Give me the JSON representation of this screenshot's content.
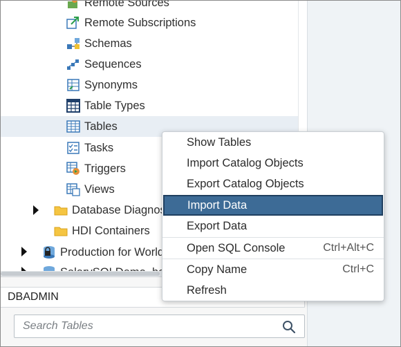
{
  "tree": {
    "items": [
      {
        "label": "Remote Sources",
        "icon": "remote-sources-icon"
      },
      {
        "label": "Remote Subscriptions",
        "icon": "remote-subscriptions-icon"
      },
      {
        "label": "Schemas",
        "icon": "schemas-icon"
      },
      {
        "label": "Sequences",
        "icon": "sequences-icon"
      },
      {
        "label": "Synonyms",
        "icon": "synonyms-icon"
      },
      {
        "label": "Table Types",
        "icon": "table-types-icon"
      },
      {
        "label": "Tables",
        "icon": "tables-icon",
        "selected": true
      },
      {
        "label": "Tasks",
        "icon": "tasks-icon"
      },
      {
        "label": "Triggers",
        "icon": "triggers-icon"
      },
      {
        "label": "Views",
        "icon": "views-icon"
      },
      {
        "label": "Database Diagnostics",
        "icon": "folder-icon"
      },
      {
        "label": "HDI Containers",
        "icon": "folder-icon"
      },
      {
        "label": "Production for World",
        "icon": "database-locked-icon"
      },
      {
        "label": "SalarySQLDemo_ha",
        "icon": "database-icon"
      }
    ]
  },
  "context_menu": {
    "items": [
      {
        "label": "Show Tables",
        "shortcut": ""
      },
      {
        "label": "Import Catalog Objects",
        "shortcut": ""
      },
      {
        "label": "Export Catalog Objects",
        "shortcut": ""
      },
      {
        "label": "Import Data",
        "shortcut": "",
        "active": true
      },
      {
        "label": "Export Data",
        "shortcut": ""
      },
      {
        "label": "Open SQL Console",
        "shortcut": "Ctrl+Alt+C"
      },
      {
        "label": "Copy Name",
        "shortcut": "Ctrl+C"
      },
      {
        "label": "Refresh",
        "shortcut": ""
      }
    ]
  },
  "bottom": {
    "database_user": "DBADMIN",
    "search_placeholder": "Search Tables"
  },
  "colors": {
    "menu_active_bg": "#3d6b96",
    "selected_row_bg": "#e8eef4",
    "folder_yellow": "#f5c542"
  }
}
